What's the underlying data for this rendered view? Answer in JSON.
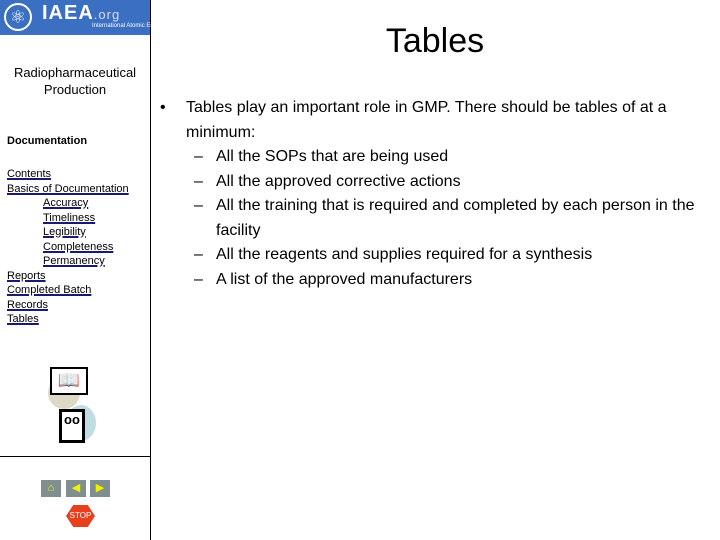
{
  "logo": {
    "name": "IAEA",
    "domain": ".org",
    "subtitle": "International Atomic Energy Agency",
    "emblem_icon": "atom-olive-emblem-icon",
    "color": "#3b6fc2"
  },
  "sidebar": {
    "course": "Radiopharmaceutical Production",
    "section": "Documentation",
    "links": [
      {
        "label": "Contents",
        "indent": false
      },
      {
        "label": "Basics of Documentation",
        "indent": false
      },
      {
        "label": "Accuracy",
        "indent": true
      },
      {
        "label": "Timeliness",
        "indent": true
      },
      {
        "label": "Legibility",
        "indent": true
      },
      {
        "label": "Completeness",
        "indent": true
      },
      {
        "label": "Permanency",
        "indent": true
      },
      {
        "label": "Reports",
        "indent": false
      },
      {
        "label": "Completed Batch",
        "indent": false
      },
      {
        "label": "Records",
        "indent": false
      },
      {
        "label": "Tables",
        "indent": false
      }
    ],
    "nav": {
      "home_icon": "home-icon",
      "back_icon": "back-icon",
      "next_icon": "next-icon",
      "stop_label": "STOP"
    }
  },
  "slide": {
    "title": "Tables",
    "bullet": "Tables play an important role in GMP.  There should be tables of at a minimum:",
    "subitems": [
      "All the SOPs that are being used",
      "All the approved corrective actions",
      "All the training that is required and completed by each person in the facility",
      "All the reagents and supplies required for a synthesis",
      "A list of the approved manufacturers"
    ]
  }
}
